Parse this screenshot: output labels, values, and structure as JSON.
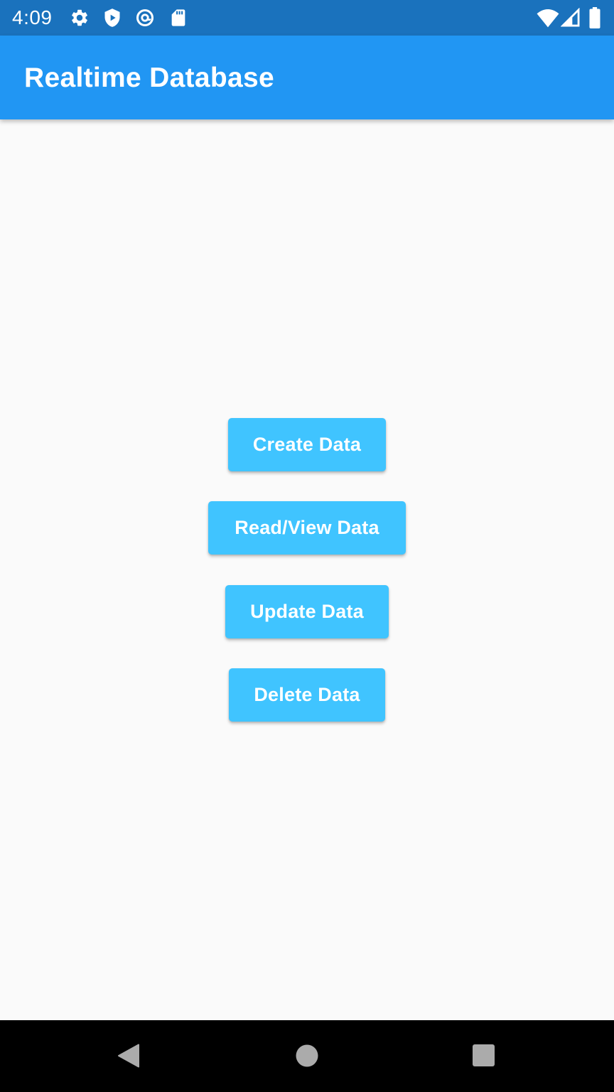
{
  "status_bar": {
    "time": "4:09",
    "left_icons": [
      "settings-icon",
      "play-protect-icon",
      "at-sign-icon",
      "sd-card-icon"
    ],
    "right_icons": [
      "wifi-icon",
      "cell-signal-icon",
      "battery-icon"
    ]
  },
  "app_bar": {
    "title": "Realtime Database",
    "color": "#2196f3"
  },
  "buttons": [
    {
      "label": "Create Data"
    },
    {
      "label": "Read/View Data"
    },
    {
      "label": "Update Data"
    },
    {
      "label": "Delete Data"
    }
  ],
  "button_color": "#40c4ff",
  "nav_bar": {
    "icons": [
      "back-icon",
      "home-icon",
      "recents-icon"
    ]
  }
}
